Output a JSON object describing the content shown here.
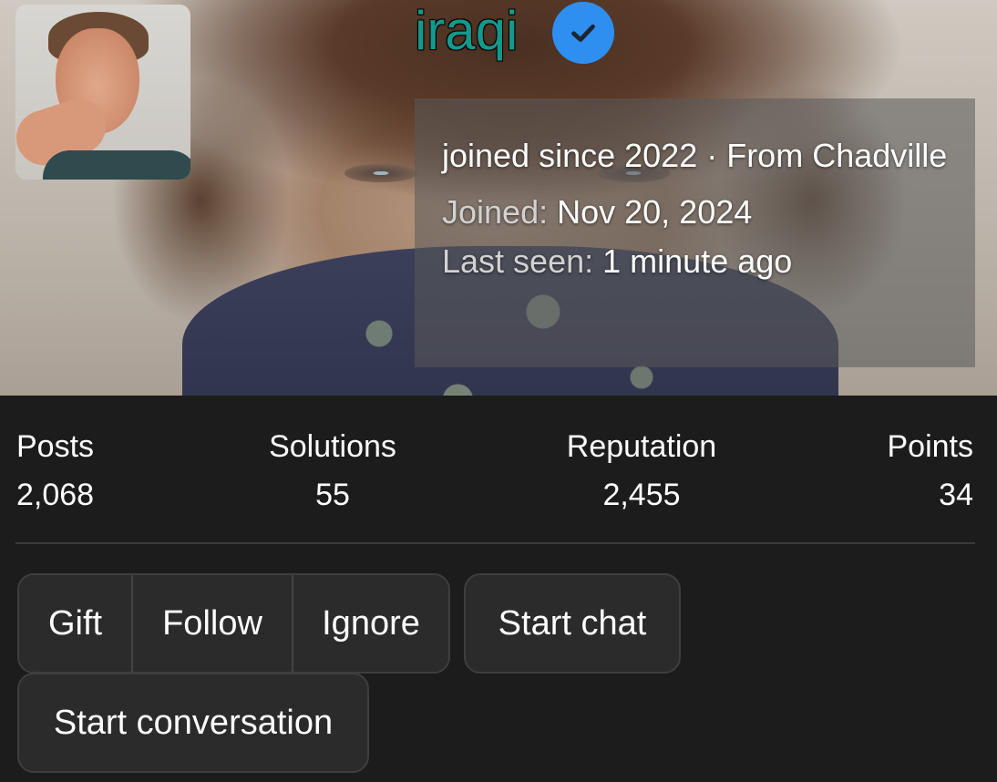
{
  "profile": {
    "username": "iraqi",
    "verified_icon": "check-badge-icon",
    "bio": "joined since 2022 · From Chadville",
    "joined_label": "Joined:",
    "joined_value": "Nov 20, 2024",
    "last_seen_label": "Last seen:",
    "last_seen_value": "1 minute ago"
  },
  "stats": [
    {
      "label": "Posts",
      "value": "2,068"
    },
    {
      "label": "Solutions",
      "value": "55"
    },
    {
      "label": "Reputation",
      "value": "2,455"
    },
    {
      "label": "Points",
      "value": "34"
    }
  ],
  "actions": {
    "gift": "Gift",
    "follow": "Follow",
    "ignore": "Ignore",
    "start_chat": "Start chat",
    "start_conversation": "Start conversation"
  },
  "colors": {
    "username": "#14998c",
    "verified_badge": "#2f8ff0",
    "page_background": "#1c1c1c",
    "button_background": "#2b2b2b"
  }
}
